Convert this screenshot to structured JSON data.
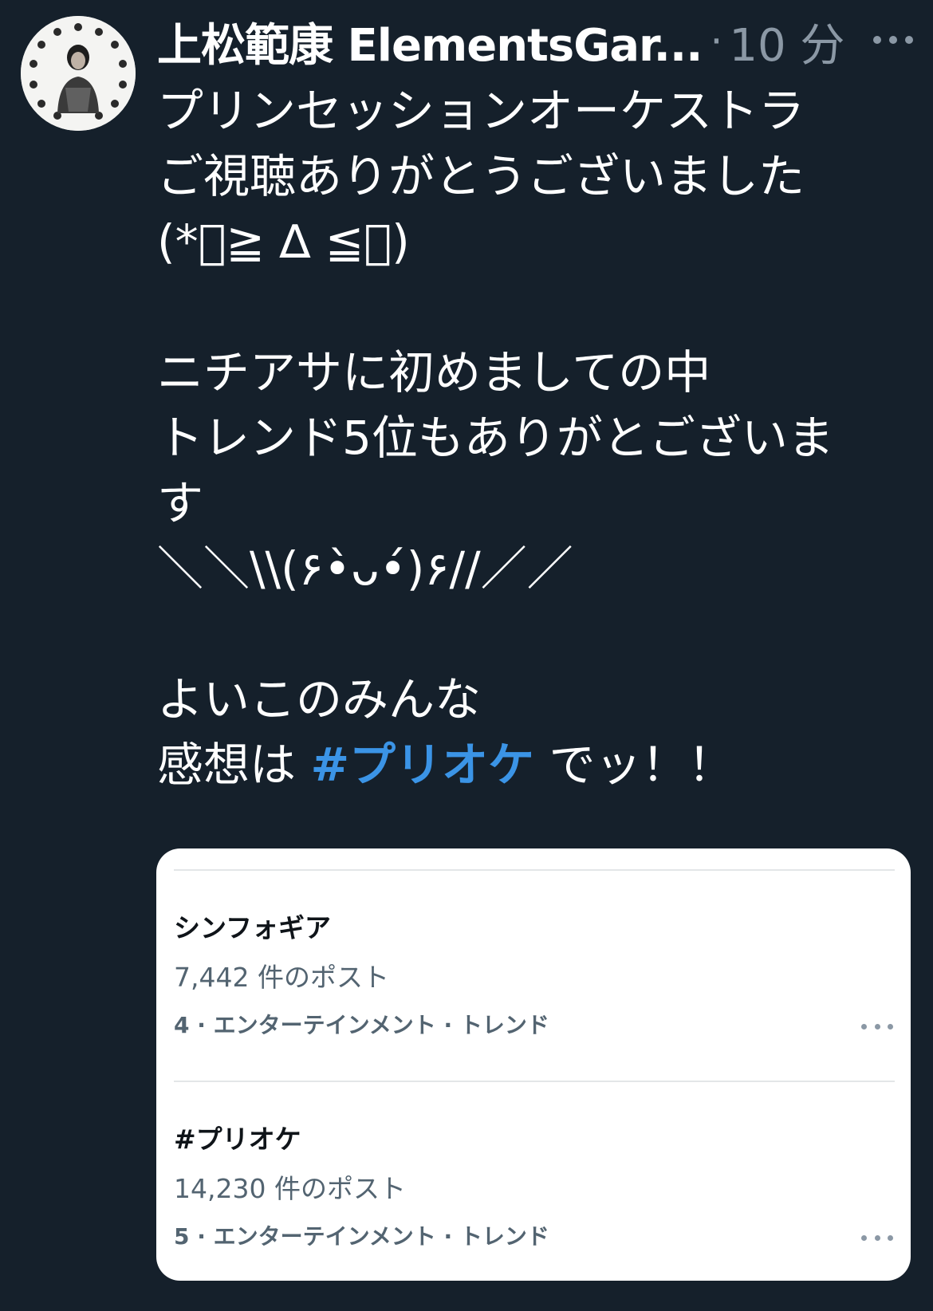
{
  "tweet": {
    "author": {
      "display_name": "上松範康 ElementsGar...",
      "avatar_icon": "profile-photo-icon"
    },
    "separator": "·",
    "timestamp": "10 分",
    "more_icon": "more-horizontal-icon",
    "lines": [
      "プリンセッションオーケストラ",
      "ご視聴ありがとうございました",
      "(*゚≧ ∆ ≦゚)",
      "",
      "ニチアサに初めましての中",
      "トレンド5位もありがとございま",
      "す",
      "＼＼\\\\(۶•̀ᴗ•́)۶//／／",
      "",
      "よいこのみんな"
    ],
    "last_line": {
      "prefix": "感想は ",
      "hashtag": "#プリオケ",
      "suffix": " でッ！！"
    }
  },
  "trends_card": {
    "items": [
      {
        "title": "シンフォギア",
        "count": "7,442 件のポスト",
        "meta": "4 · エンターテインメント · トレンド"
      },
      {
        "title": "#プリオケ",
        "count": "14,230 件のポスト",
        "meta": "5 · エンターテインメント · トレンド"
      }
    ]
  },
  "colors": {
    "background": "#15202b",
    "text": "#ffffff",
    "muted": "#8b98a5",
    "hashtag": "#3b94e6",
    "card_background": "#ffffff"
  }
}
